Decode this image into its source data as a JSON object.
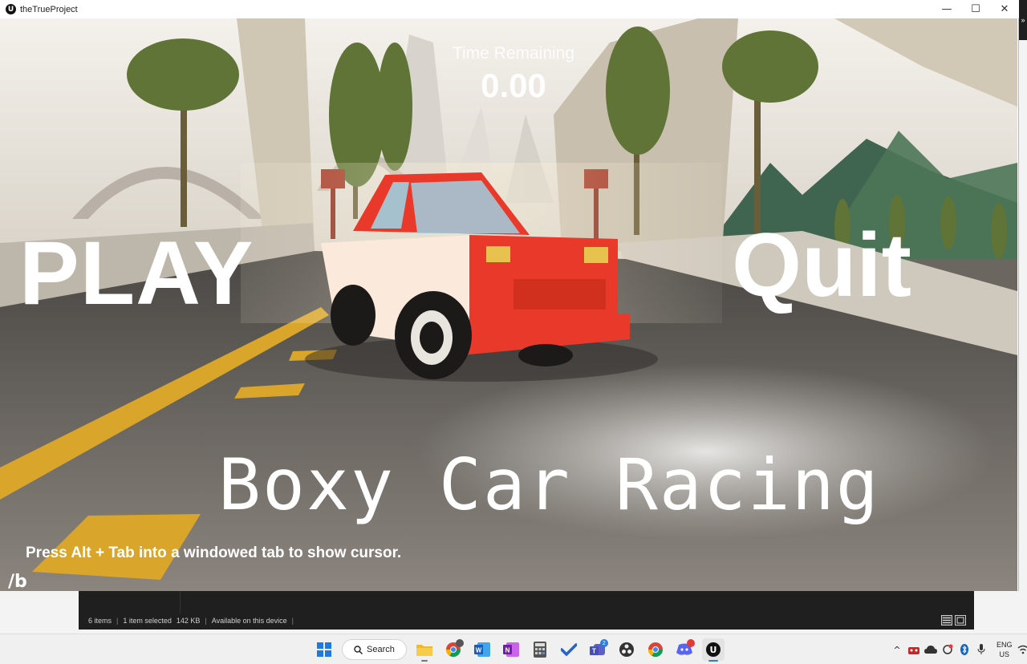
{
  "window": {
    "title": "theTrueProject",
    "logo_glyph": "U",
    "controls": {
      "minimize": "—",
      "maximize": "☐",
      "close": "✕"
    }
  },
  "hud": {
    "time_label": "Time Remaining",
    "time_value": "0.00"
  },
  "menu": {
    "play_label": "PLAY",
    "quit_label": "Quit"
  },
  "game_title": "Boxy Car Racing",
  "hint_text": "Press Alt + Tab into a windowed tab to show cursor.",
  "corner_mark": "/b",
  "explorer": {
    "items_count": "6 items",
    "selected": "1 item selected",
    "size": "142 KB",
    "availability": "Available on this device",
    "separator": "|"
  },
  "side_tab": "»",
  "taskbar": {
    "search_label": "Search",
    "edge_badge": "2",
    "chrome_badge": "",
    "language_line1": "ENG",
    "language_line2": "US"
  },
  "colors": {
    "car_red": "#e8392a",
    "road_yellow": "#e6b22a",
    "sky": "#e9e4dc",
    "taskbar": "#f0f0f0"
  }
}
